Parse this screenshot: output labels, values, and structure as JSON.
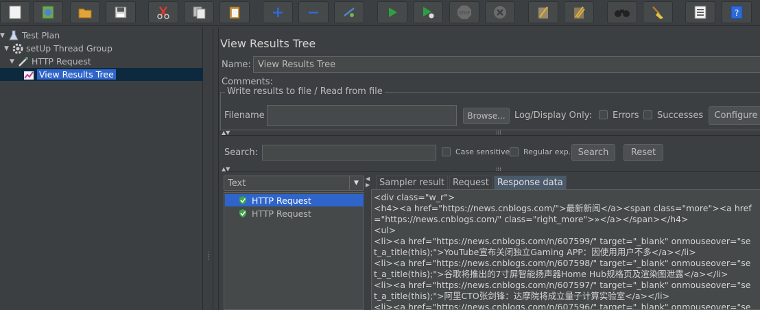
{
  "toolbar": {
    "buttons": [
      {
        "name": "new",
        "icon": "new-file-icon"
      },
      {
        "name": "templates",
        "icon": "templates-icon"
      },
      {
        "name": "open",
        "icon": "open-folder-icon"
      },
      {
        "name": "save",
        "icon": "save-icon"
      },
      {
        "name": "cut",
        "icon": "cut-icon"
      },
      {
        "name": "copy",
        "icon": "copy-icon"
      },
      {
        "name": "paste",
        "icon": "paste-icon"
      },
      {
        "name": "expand",
        "icon": "plus-icon"
      },
      {
        "name": "collapse",
        "icon": "minus-icon"
      },
      {
        "name": "toggle",
        "icon": "toggle-icon"
      },
      {
        "name": "start",
        "icon": "play-icon"
      },
      {
        "name": "start-no-pause",
        "icon": "play-no-timer-icon"
      },
      {
        "name": "stop",
        "icon": "stop-icon"
      },
      {
        "name": "shutdown",
        "icon": "shutdown-icon"
      },
      {
        "name": "clear",
        "icon": "broom-clear-icon"
      },
      {
        "name": "clear-all",
        "icon": "broom-clear-all-icon"
      },
      {
        "name": "search",
        "icon": "binoculars-icon"
      },
      {
        "name": "reset-search",
        "icon": "broom-icon"
      },
      {
        "name": "function-helper",
        "icon": "list-icon"
      },
      {
        "name": "help",
        "icon": "help-icon"
      }
    ],
    "colors": {
      "green": "#2ea043",
      "blue": "#2e6bd8",
      "red": "#d63b2f",
      "gray": "#8a8a8a"
    }
  },
  "tree": {
    "items": [
      {
        "label": "Test Plan",
        "icon": "flask-icon"
      },
      {
        "label": "setUp Thread Group",
        "icon": "gear-icon"
      },
      {
        "label": "HTTP Request",
        "icon": "pipette-icon"
      },
      {
        "label": "View Results Tree",
        "icon": "chart-icon"
      }
    ]
  },
  "panel": {
    "title": "View Results Tree",
    "name_label": "Name:",
    "name_value": "View Results Tree",
    "comments_label": "Comments:",
    "file_group_title": "Write results to file / Read from file",
    "filename_label": "Filename",
    "filename_value": "",
    "browse_label": "Browse...",
    "log_display_label": "Log/Display Only:",
    "errors_label": "Errors",
    "successes_label": "Successes",
    "configure_label": "Configure",
    "search_label": "Search:",
    "search_value": "",
    "case_sensitive_label": "Case sensitive",
    "regex_label": "Regular exp.",
    "search_button": "Search",
    "reset_button": "Reset"
  },
  "results": {
    "renderer": "Text",
    "items": [
      {
        "label": "HTTP Request",
        "status": "success"
      },
      {
        "label": "HTTP Request",
        "status": "success"
      }
    ]
  },
  "tabs": [
    "Sampler result",
    "Request",
    "Response data"
  ],
  "active_tab": "Response data",
  "response_lines": [
    "<div class=\"w_r\">",
    "<h4><a href=\"https://news.cnblogs.com/\">最新新闻</a><span class=\"more\"><a href",
    "=\"https://news.cnblogs.com/\" class=\"right_more\">»</a></span></h4>",
    "<ul>",
    "<li><a href=\"https://news.cnblogs.com/n/607599/\" target=\"_blank\" onmouseover=\"se",
    "t_a_title(this);\">YouTube宣布关闭独立Gaming APP：因使用用户不多</a></li>",
    "<li><a href=\"https://news.cnblogs.com/n/607598/\" target=\"_blank\" onmouseover=\"se",
    "t_a_title(this);\">谷歌将推出的7寸屏智能扬声器Home Hub规格页及渲染图泄露</a></li>",
    "<li><a href=\"https://news.cnblogs.com/n/607597/\" target=\"_blank\" onmouseover=\"se",
    "t_a_title(this);\">阿里CTO张剑锋：达摩院将成立量子计算实验室</a></li>",
    "<li><a href=\"https://news.cnblogs.com/n/607596/\" target=\"_blank\" onmouseover=\"se"
  ]
}
